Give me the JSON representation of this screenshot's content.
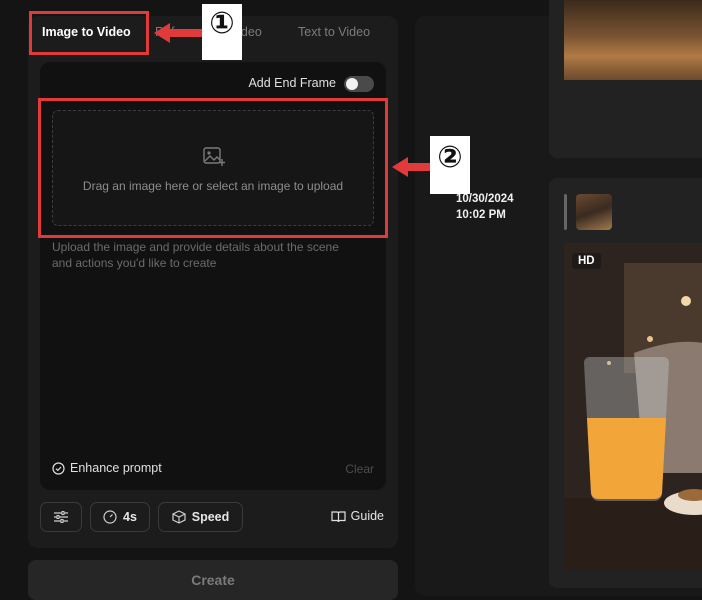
{
  "tabs": [
    {
      "label": "Image to Video",
      "active": true
    },
    {
      "label": "Reference to Video",
      "active": false
    },
    {
      "label": "Text to Video",
      "active": false
    }
  ],
  "upload": {
    "end_frame_label": "Add End Frame",
    "end_frame_enabled": false,
    "dropzone_text": "Drag an image here or select an image to upload",
    "prompt_placeholder": "Upload the image and provide details about the scene and actions you'd like to create",
    "enhance_label": "Enhance prompt",
    "clear_label": "Clear"
  },
  "toolbar": {
    "duration_label": "4s",
    "speed_label": "Speed",
    "guide_label": "Guide"
  },
  "create_label": "Create",
  "history": {
    "date": "10/30/2024",
    "time": "10:02 PM",
    "quality_badge": "HD"
  },
  "annotations": {
    "marker_1": "①",
    "marker_2": "②",
    "color": "#e03a3a"
  },
  "icons": [
    "image-add-icon",
    "sparkle-check-icon",
    "sliders-icon",
    "timer-icon",
    "speed-cube-icon",
    "book-icon"
  ]
}
